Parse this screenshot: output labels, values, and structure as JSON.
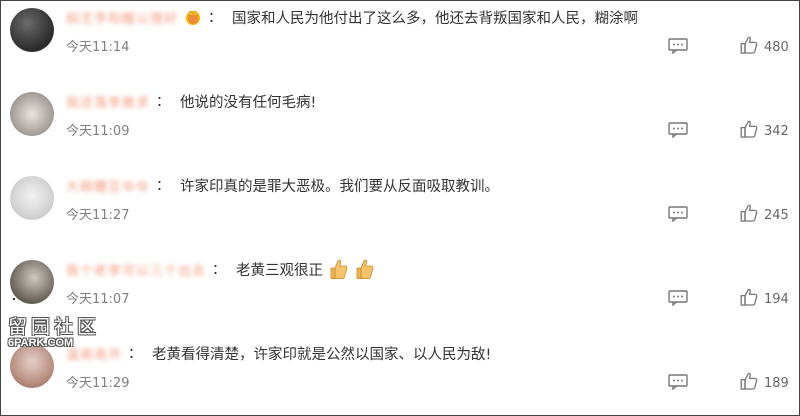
{
  "comments": [
    {
      "user": "焖尤亨阳醒以理好",
      "text": "国家和人民为他付出了这么多，他还去背叛国家和人民，糊涂啊",
      "time": "今天11:14",
      "likes": "480",
      "badge": "crown-icon",
      "emojis": []
    },
    {
      "user": "我还落李推求",
      "text": "他说的没有任何毛病!",
      "time": "今天11:09",
      "likes": "342",
      "badge": "",
      "emojis": []
    },
    {
      "user": "大碗糖豆ゆゆ",
      "text": "许家印真的是罪大恶极。我们要从反面吸取教训。",
      "time": "今天11:27",
      "likes": "245",
      "badge": "",
      "emojis": []
    },
    {
      "user": "我个老李可以三个出去",
      "text": "老黄三观很正",
      "time": "今天11:07",
      "likes": "194",
      "badge": "",
      "emojis": [
        "thumbs-up-emoji",
        "thumbs-up-emoji"
      ]
    },
    {
      "user": "温南南开",
      "text": "老黄看得清楚，许家印就是公然以国家、以人民为敌!",
      "time": "今天11:29",
      "likes": "189",
      "badge": "",
      "emojis": []
    }
  ],
  "colon": "：",
  "watermark": {
    "cn": "留园社区",
    "en": "6PARK.COM"
  },
  "colors": {
    "username": "#f29a7e",
    "text": "#333333",
    "meta": "#808080",
    "icon": "#777777"
  }
}
